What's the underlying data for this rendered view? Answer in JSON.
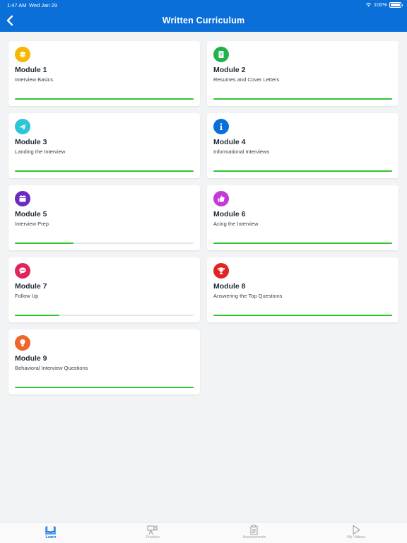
{
  "status_bar": {
    "time": "1:47 AM",
    "date": "Wed Jan 29",
    "battery": "100%"
  },
  "header": {
    "title": "Written Curriculum",
    "back_icon": "chevron-left-icon",
    "color": "#0a6fd8"
  },
  "modules": [
    {
      "name": "Module 1",
      "description": "Interview Basics",
      "icon": "signpost-icon",
      "icon_color": "#f5b800",
      "progress": 1.0
    },
    {
      "name": "Module 2",
      "description": "Resumes and Cover Letters",
      "icon": "document-icon",
      "icon_color": "#22b14c",
      "progress": 1.0
    },
    {
      "name": "Module 3",
      "description": "Landing the Interview",
      "icon": "airplane-icon",
      "icon_color": "#2cc5d8",
      "progress": 1.0
    },
    {
      "name": "Module 4",
      "description": "Informational Interviews",
      "icon": "info-icon",
      "icon_color": "#0a6fd8",
      "progress": 1.0
    },
    {
      "name": "Module 5",
      "description": "Interview Prep",
      "icon": "calendar-icon",
      "icon_color": "#6a2cc0",
      "progress": 0.33
    },
    {
      "name": "Module 6",
      "description": "Acing the Interview",
      "icon": "thumbs-up-icon",
      "icon_color": "#c43ad6",
      "progress": 1.0
    },
    {
      "name": "Module 7",
      "description": "Follow Up",
      "icon": "speech-bubble-icon",
      "icon_color": "#e0245e",
      "progress": 0.25
    },
    {
      "name": "Module 8",
      "description": "Answering the Top Questions",
      "icon": "trophy-icon",
      "icon_color": "#e02424",
      "progress": 1.0
    },
    {
      "name": "Module 9",
      "description": "Behavioral Interview Questions",
      "icon": "lightbulb-icon",
      "icon_color": "#f0652a",
      "progress": 1.0
    }
  ],
  "progress_colors": {
    "fill": "#2ec42e",
    "track": "#e3e5e8"
  },
  "tabs": [
    {
      "label": "Learn",
      "icon": "book-icon",
      "active": true
    },
    {
      "label": "Practice",
      "icon": "camera-icon",
      "active": false
    },
    {
      "label": "Assessments",
      "icon": "clipboard-icon",
      "active": false
    },
    {
      "label": "My Videos",
      "icon": "play-icon",
      "active": false
    }
  ]
}
